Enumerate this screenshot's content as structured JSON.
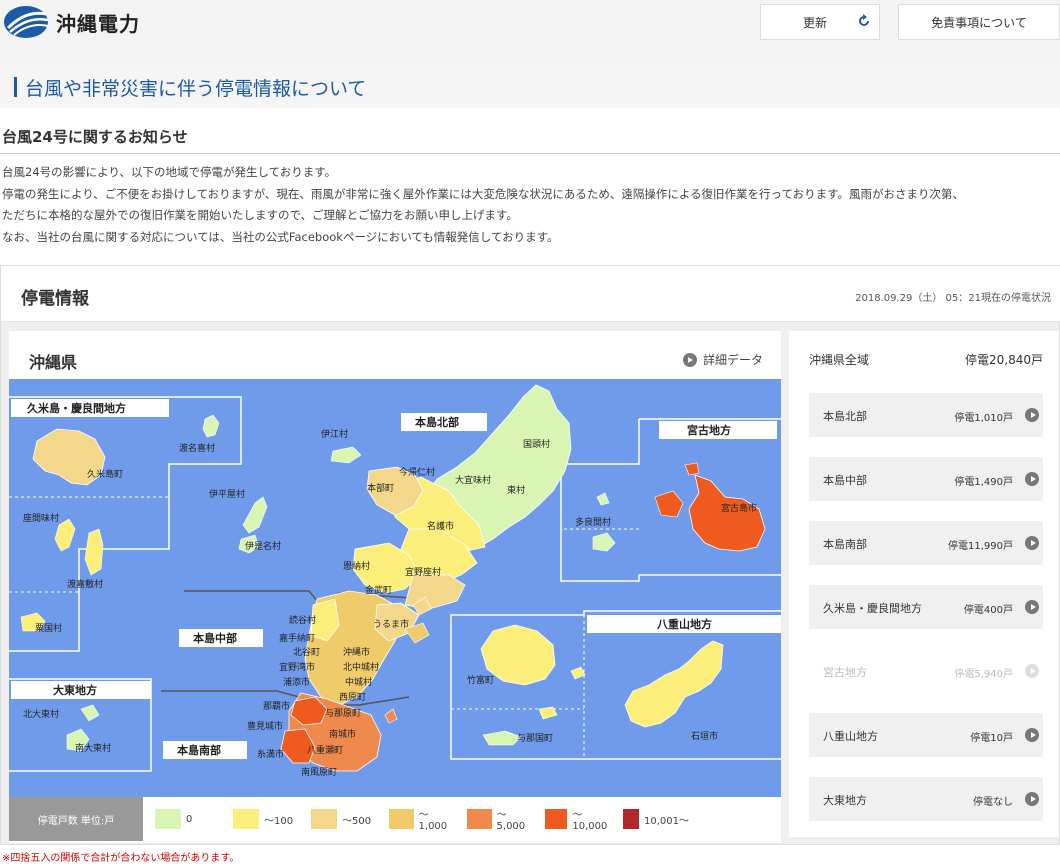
{
  "header": {
    "logo_text": "沖縄電力",
    "refresh_label": "更新",
    "disclaimer_label": "免責事項について"
  },
  "page_title": "台風や非常災害に伴う停電情報について",
  "notice": {
    "title": "台風24号に関するお知らせ",
    "lines": [
      "台風24号の影響により、以下の地域で停電が発生しております。",
      "停電の発生により、ご不便をお掛けしておりますが、現在、雨風が非常に強く屋外作業には大変危険な状況にあるため、遠隔操作による復旧作業を行っております。風雨がおさまり次第、",
      "ただちに本格的な屋外での復旧作業を開始いたしますので、ご理解とご協力をお願い申し上げます。",
      "なお、当社の台風に関する対応については、当社の公式Facebookページにおいても情報発信しております。"
    ]
  },
  "outage": {
    "title": "停電情報",
    "datetime": "2018.09.29（土） 05：21現在の停電状況",
    "map_title": "沖縄県",
    "detail_link": "詳細データ"
  },
  "map_labels": {
    "regions": {
      "kume_kerama": "久米島・慶良間地方",
      "hontou_north": "本島北部",
      "miyako": "宮古地方",
      "hontou_central": "本島中部",
      "yaeyama": "八重山地方",
      "daito": "大東地方",
      "hontou_south": "本島南部"
    },
    "municipalities": {
      "tonaki": "渡名喜村",
      "kumejima": "久米島町",
      "zamami": "座間味村",
      "tokashiki": "渡嘉敷村",
      "aguni": "粟国村",
      "iheya": "伊平屋村",
      "izena": "伊是名村",
      "ie": "伊江村",
      "nakijin": "今帰仁村",
      "motobu": "本部町",
      "ogimi": "大宜味村",
      "kunigami": "国頭村",
      "higashi": "東村",
      "nago": "名護市",
      "onna": "恩納村",
      "ginoza": "宜野座村",
      "kin": "金武町",
      "yomitan": "読谷村",
      "uruma": "うるま市",
      "kadena": "嘉手納町",
      "chatan": "北谷町",
      "okinawa": "沖縄市",
      "kitanakagusuku": "北中城村",
      "ginowan": "宜野湾市",
      "nakagusuku": "中城村",
      "urasoe": "浦添市",
      "nishihara": "西原町",
      "naha": "那覇市",
      "yonabaru": "与那原町",
      "tomigusuku": "豊見城市",
      "nanjo": "南城市",
      "itoman": "糸満市",
      "yaese": "八重瀬町",
      "haebaru": "南風原町",
      "tarama": "多良間村",
      "miyakojima": "宮古島市",
      "taketomi": "竹富町",
      "yonaguni": "与那国町",
      "ishigaki": "石垣市",
      "kitadaito": "北大東村",
      "minamidaito": "南大東村"
    }
  },
  "legend": {
    "title": "停電戸数 単位:戸",
    "items": [
      {
        "label": "0",
        "color": "#d9f5b3"
      },
      {
        "label": "〜100",
        "color": "#fbee7a"
      },
      {
        "label": "〜500",
        "color": "#f3d88c"
      },
      {
        "label": "〜1,000",
        "color": "#f0cb6a"
      },
      {
        "label": "〜5,000",
        "color": "#ef8a4c"
      },
      {
        "label": "〜10,000",
        "color": "#ef5a1e"
      },
      {
        "label": "10,001〜",
        "color": "#b2262c"
      }
    ]
  },
  "summary": {
    "total_label": "沖縄県全域",
    "total_value": "停電20,840戸",
    "rows": [
      {
        "name": "本島北部",
        "value": "停電1,010戸"
      },
      {
        "name": "本島中部",
        "value": "停電1,490戸"
      },
      {
        "name": "本島南部",
        "value": "停電11,990戸"
      },
      {
        "name": "久米島・慶良間地方",
        "value": "停電400戸"
      },
      {
        "name": "宮古地方",
        "value": "停電5,940戸"
      },
      {
        "name": "八重山地方",
        "value": "停電10戸"
      },
      {
        "name": "大東地方",
        "value": "停電なし"
      }
    ]
  },
  "footnote": "※四捨五入の関係で合計が合わない場合があります。"
}
